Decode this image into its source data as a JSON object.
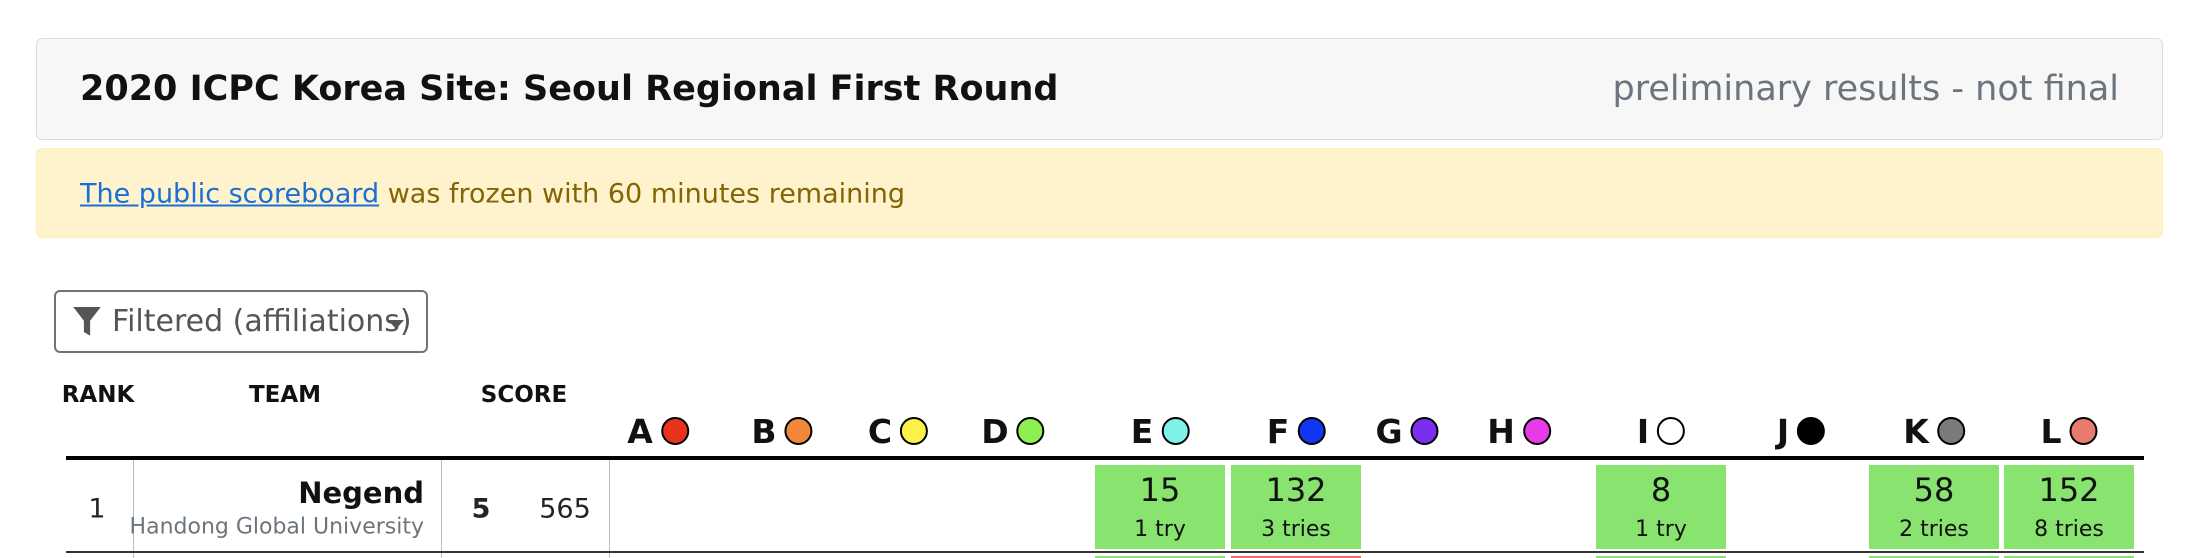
{
  "header": {
    "title": "2020 ICPC Korea Site: Seoul Regional First Round",
    "status": "preliminary results - not final"
  },
  "alert": {
    "link_text": "The public scoreboard",
    "message": " was frozen with 60 minutes remaining"
  },
  "filter": {
    "label": "Filtered (affiliations)"
  },
  "columns": {
    "rank": "RANK",
    "team": "TEAM",
    "score": "SCORE"
  },
  "problems": [
    {
      "letter": "A",
      "color": "#e8321c"
    },
    {
      "letter": "B",
      "color": "#f0873a"
    },
    {
      "letter": "C",
      "color": "#faf248"
    },
    {
      "letter": "D",
      "color": "#8ef050"
    },
    {
      "letter": "E",
      "color": "#7ef2e6"
    },
    {
      "letter": "F",
      "color": "#1136f2"
    },
    {
      "letter": "G",
      "color": "#7a2ef0"
    },
    {
      "letter": "H",
      "color": "#e63be6"
    },
    {
      "letter": "I",
      "color": "#ffffff"
    },
    {
      "letter": "J",
      "color": "#000000"
    },
    {
      "letter": "K",
      "color": "#7a7a7a"
    },
    {
      "letter": "L",
      "color": "#e87a6e"
    }
  ],
  "rows": [
    {
      "rank": "1",
      "team": "Negend",
      "affiliation": "Handong Global University",
      "solved": "5",
      "penalty": "565",
      "results": [
        {
          "problem": "E",
          "time": "15",
          "tries": "1 try"
        },
        {
          "problem": "F",
          "time": "132",
          "tries": "3 tries"
        },
        {
          "problem": "I",
          "time": "8",
          "tries": "1 try"
        },
        {
          "problem": "K",
          "time": "58",
          "tries": "2 tries"
        },
        {
          "problem": "L",
          "time": "152",
          "tries": "8 tries"
        }
      ]
    }
  ],
  "colors": {
    "solved": "#88e36f",
    "failed": "#f06a6a"
  }
}
